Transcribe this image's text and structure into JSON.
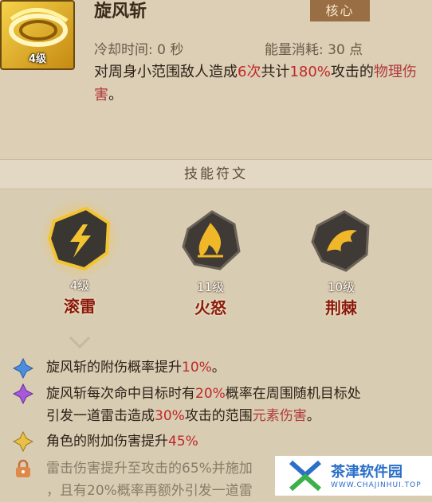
{
  "skill": {
    "name": "旋风斩",
    "level": "4级",
    "tag": "核心",
    "cooldown": "冷却时间: 0 秒",
    "energy": "能量消耗: 30 点",
    "desc_parts": [
      "对周身小范围敌人造成",
      "6次",
      "共计",
      "180%",
      "攻击的",
      "物理伤害",
      "。"
    ]
  },
  "runes": {
    "title": "技能符文",
    "items": [
      {
        "level": "4级",
        "name": "滚雷",
        "icon": "thunder-rune-icon"
      },
      {
        "level": "11级",
        "name": "火怒",
        "icon": "fire-rune-icon"
      },
      {
        "level": "10级",
        "name": "荆棘",
        "icon": "thorn-rune-icon"
      }
    ]
  },
  "effects": [
    {
      "icon": "blue-diamond-icon",
      "parts": [
        "旋风斩的附伤概率提升",
        "10%",
        "。"
      ]
    },
    {
      "icon": "purple-diamond-icon",
      "line1": [
        "旋风斩每次命中目标时有",
        "20%",
        "概率在周围随机目标处"
      ],
      "line2": [
        "引发一道雷击造成",
        "30%",
        "攻击的范围",
        "元素伤害",
        "。"
      ]
    },
    {
      "icon": "gold-diamond-icon",
      "parts": [
        "角色的附加伤害提升",
        "45%"
      ]
    },
    {
      "icon": "lock-icon",
      "line1": [
        "雷击伤害提升至攻击的",
        "65%",
        "并施加"
      ],
      "line2": [
        "，且有",
        "20%",
        "概率再额外引发一道雷"
      ]
    }
  ],
  "watermark": {
    "title": "茶津软件园",
    "url": "WWW.CHAJINHUI.TOP"
  },
  "colors": {
    "highlight": "#c0282a",
    "rune_name": "#8a1a10",
    "core_tag": "#9a6e44"
  }
}
